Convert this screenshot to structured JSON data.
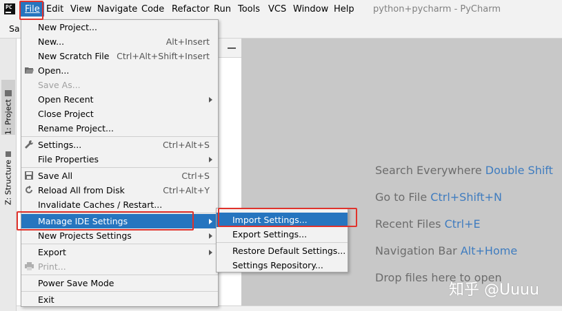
{
  "app": {
    "logo_text": "PC",
    "title": "python+pycharm - PyCharm",
    "crumb": "Sa"
  },
  "menubar": {
    "file": "File",
    "edit": "Edit",
    "view": "View",
    "navigate": "Navigate",
    "code": "Code",
    "refactor": "Refactor",
    "run": "Run",
    "tools": "Tools",
    "vcs": "VCS",
    "window": "Window",
    "help": "Help"
  },
  "left_strip": {
    "project_tab": "1: Project",
    "structure_tab": "Z: Structure"
  },
  "file_menu": {
    "new_project": "New Project...",
    "new": "New...",
    "new_shortcut": "Alt+Insert",
    "new_scratch": "New Scratch File",
    "new_scratch_shortcut": "Ctrl+Alt+Shift+Insert",
    "open": "Open...",
    "save_as": "Save As...",
    "open_recent": "Open Recent",
    "close_project": "Close Project",
    "rename_project": "Rename Project...",
    "settings": "Settings...",
    "settings_shortcut": "Ctrl+Alt+S",
    "file_properties": "File Properties",
    "save_all": "Save All",
    "save_all_shortcut": "Ctrl+S",
    "reload": "Reload All from Disk",
    "reload_shortcut": "Ctrl+Alt+Y",
    "invalidate": "Invalidate Caches / Restart...",
    "manage_ide": "Manage IDE Settings",
    "new_projects_settings": "New Projects Settings",
    "export": "Export",
    "print": "Print...",
    "power_save": "Power Save Mode",
    "exit": "Exit"
  },
  "submenu": {
    "import_settings": "Import Settings...",
    "export_settings": "Export Settings...",
    "restore_defaults": "Restore Default Settings...",
    "settings_repository": "Settings Repository..."
  },
  "editor_hints": {
    "search_label": "Search Everywhere",
    "search_shortcut": "Double Shift",
    "goto_label": "Go to File",
    "goto_shortcut": "Ctrl+Shift+N",
    "recent_label": "Recent Files",
    "recent_shortcut": "Ctrl+E",
    "navbar_label": "Navigation Bar",
    "navbar_shortcut": "Alt+Home",
    "drop_label": "Drop files here to open"
  },
  "watermark": "知乎 @Uuuu",
  "colors": {
    "highlight": "#2675bf",
    "annotation_red": "#e0322b",
    "shortcut_blue": "#3f7cbf"
  }
}
